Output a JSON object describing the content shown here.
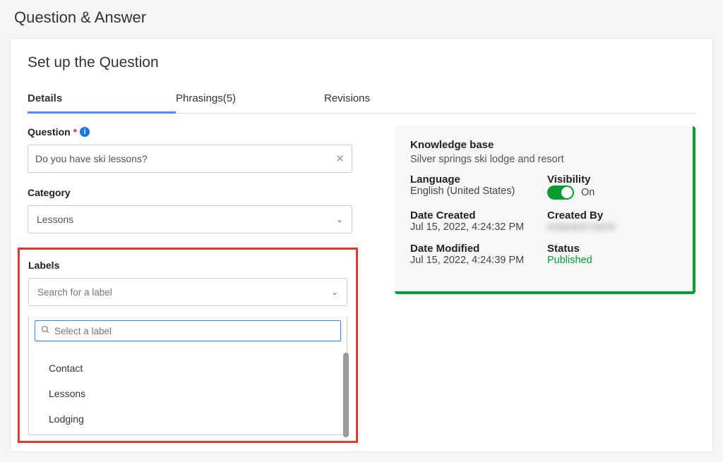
{
  "page": {
    "title": "Question & Answer"
  },
  "card": {
    "title": "Set up the Question"
  },
  "tabs": {
    "details": "Details",
    "phrasings": "Phrasings(5)",
    "revisions": "Revisions"
  },
  "form": {
    "question_label": "Question",
    "question_required_mark": "*",
    "question_value": "Do you have ski lessons?",
    "category_label": "Category",
    "category_value": "Lessons",
    "labels_label": "Labels",
    "labels_placeholder": "Search for a label",
    "labels_search_placeholder": "Select a label",
    "label_options": [
      "Contact",
      "Lessons",
      "Lodging"
    ]
  },
  "info": {
    "kb_label": "Knowledge base",
    "kb_value": "Silver springs ski lodge and resort",
    "language_label": "Language",
    "language_value": "English (United States)",
    "visibility_label": "Visibility",
    "visibility_value": "On",
    "date_created_label": "Date Created",
    "date_created_value": "Jul 15, 2022, 4:24:32 PM",
    "created_by_label": "Created By",
    "created_by_value": "redacted name",
    "date_modified_label": "Date Modified",
    "date_modified_value": "Jul 15, 2022, 4:24:39 PM",
    "status_label": "Status",
    "status_value": "Published"
  }
}
